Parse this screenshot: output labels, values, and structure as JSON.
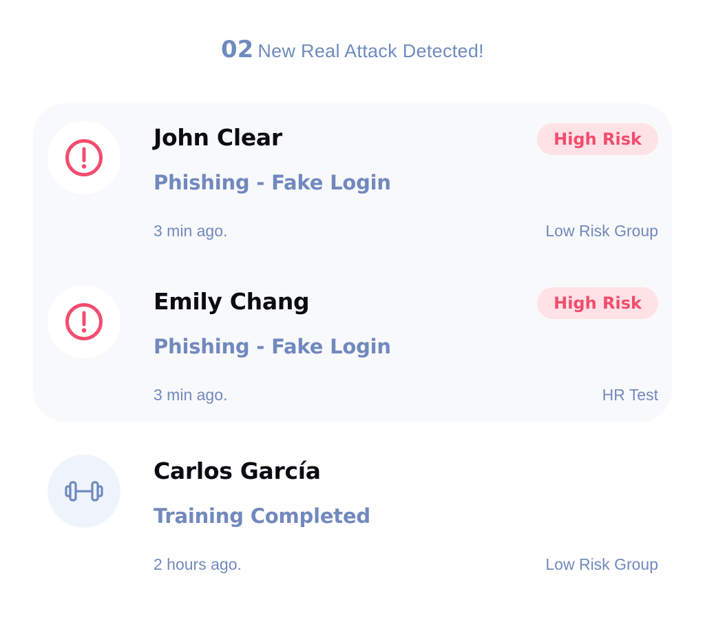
{
  "header": {
    "count": "02",
    "title": "New Real Attack Detected!"
  },
  "colors": {
    "accent_blue": "#7189bd",
    "risk_red": "#f24d6e",
    "risk_badge_bg": "#ffe2e6",
    "panel_bg": "#f8f9fb"
  },
  "items": [
    {
      "name": "John Clear",
      "event": "Phishing - Fake Login",
      "time": "3 min ago.",
      "group": "Low Risk Group",
      "badge": "High Risk",
      "icon": "alert-circle-icon"
    },
    {
      "name": "Emily Chang",
      "event": "Phishing - Fake Login",
      "time": "3 min ago.",
      "group": "HR Test",
      "badge": "High Risk",
      "icon": "alert-circle-icon"
    },
    {
      "name": "Carlos García",
      "event": "Training Completed",
      "time": "2 hours ago.",
      "group": "Low Risk Group",
      "icon": "dumbbell-icon"
    }
  ]
}
